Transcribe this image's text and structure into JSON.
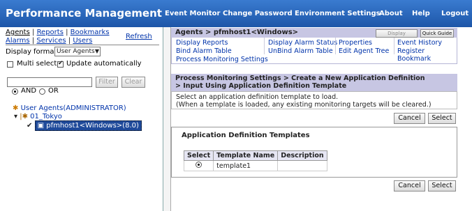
{
  "topbar": {
    "title": "Performance Management",
    "nav": [
      "Event Monitor",
      "Change Password",
      "Environment Settings",
      "About",
      "Help",
      "Logout"
    ]
  },
  "left": {
    "tabs_row1": [
      "Agents",
      "Reports",
      "Bookmarks"
    ],
    "tabs_row2": [
      "Alarms",
      "Services",
      "Users"
    ],
    "refresh": "Refresh",
    "display_format_label": "Display format",
    "display_format_value": "User Agents",
    "multi_select_label": "Multi select",
    "update_auto_label": "Update automatically",
    "filter_input_value": "",
    "filter_button": "Filter",
    "clear_button": "Clear",
    "and_label": "AND",
    "or_label": "OR",
    "tree": {
      "root": "User Agents(ADMINISTRATOR)",
      "group": "01_Tokyo",
      "host": "pfmhost1<Windows>(8.0)"
    }
  },
  "right": {
    "header": "Agents > pfmhost1<Windows>",
    "display_summary": "Display Summary",
    "quick_guide": "Quick Guide",
    "links": [
      [
        "Display Reports",
        "Display Alarm Status",
        "Properties",
        "Event History"
      ],
      [
        "Bind Alarm Table",
        "UnBind Alarm Table",
        "Edit Agent Tree",
        "Register Bookmark"
      ],
      [
        "Process Monitoring Settings",
        "",
        "",
        ""
      ]
    ],
    "breadcrumb_line1": "Process Monitoring Settings >  Create a New Application Definition",
    "breadcrumb_line2": "> Input Using Application Definition Template",
    "instructions_line1": "Select an application definition template to load.",
    "instructions_line2": "(When a template is loaded, any existing monitoring targets will be cleared.)",
    "cancel": "Cancel",
    "select": "Select",
    "templates_title": "Application Definition Templates",
    "table_headers": [
      "Select",
      "Template Name",
      "Description"
    ],
    "table_rows": [
      {
        "template": "template1",
        "description": ""
      }
    ]
  }
}
